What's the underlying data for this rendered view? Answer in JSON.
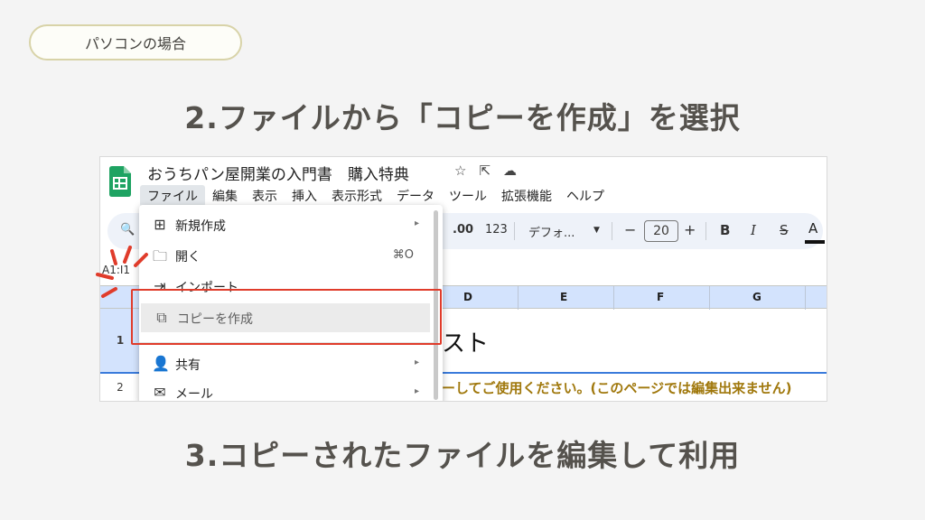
{
  "pill_label": "パソコンの場合",
  "step2": "2.ファイルから「コピーを作成」を選択",
  "step3": "3.コピーされたファイルを編集して利用",
  "sheet": {
    "doc_title": "おうちパン屋開業の入門書　購入特典",
    "title_icons": [
      "star-icon",
      "move-to-folder-icon",
      "cloud-status-icon"
    ],
    "menubar": [
      "ファイル",
      "編集",
      "表示",
      "挿入",
      "表示形式",
      "データ",
      "ツール",
      "拡張機能",
      "ヘルプ"
    ],
    "toolbar": {
      "decimal": ".00",
      "format_123": "123",
      "font": "デフォ...",
      "font_size": "20",
      "minus": "−",
      "plus": "+",
      "bold": "B",
      "italic": "I",
      "strike": "S",
      "text_color": "A"
    },
    "namebox": "A1:I1",
    "columns": [
      "D",
      "E",
      "F",
      "G"
    ],
    "rows": [
      "1",
      "2"
    ],
    "cell_big": "スト",
    "cell_note": "ーしてご使用ください。(このページでは編集出来ません)",
    "file_menu": [
      {
        "icon": "plus-box-icon",
        "label": "新規作成",
        "submenu": "▸"
      },
      {
        "icon": "folder-icon",
        "label": "開く",
        "shortcut": "⌘O"
      },
      {
        "icon": "import-icon",
        "label": "インポート"
      },
      {
        "icon": "copy-icon",
        "label": "コピーを作成"
      },
      {
        "icon": "share-person-icon",
        "label": "共有",
        "submenu": "▸"
      },
      {
        "icon": "mail-icon",
        "label": "メール",
        "submenu": "▸"
      }
    ]
  },
  "colors": {
    "highlight_box": "#e03c2b",
    "sheets_green": "#1ea362",
    "header_blue": "#d3e3fd",
    "note_text": "#a0780c"
  }
}
